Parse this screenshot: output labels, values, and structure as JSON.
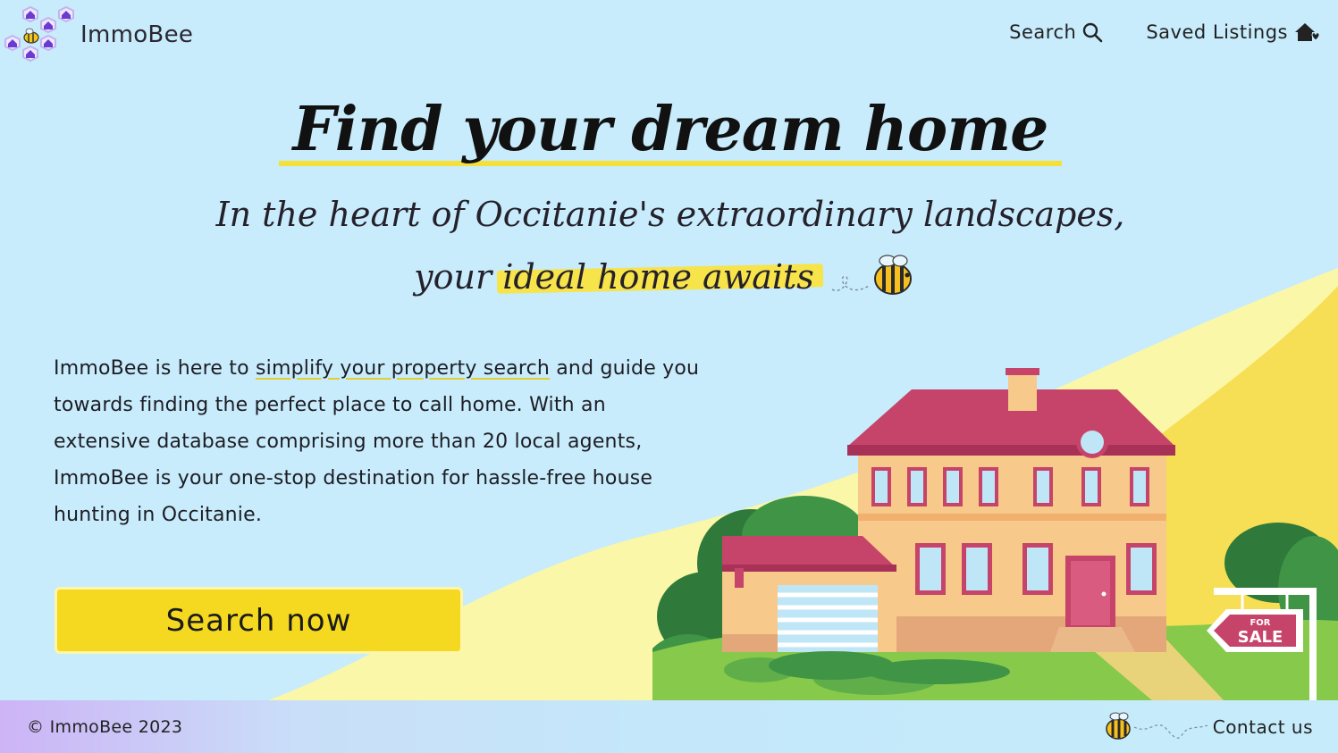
{
  "header": {
    "logo_text": "ImmoBee",
    "nav": {
      "search_label": "Search",
      "saved_label": "Saved Listings"
    }
  },
  "hero": {
    "title": "Find your dream home",
    "tagline_line1": "In the heart of Occitanie's extraordinary landscapes,",
    "tagline_line2_prefix": "your",
    "tagline_highlight": "ideal home awaits"
  },
  "intro": {
    "part1": "ImmoBee is here to ",
    "link_text": "simplify your property search",
    "part2": " and guide you towards finding the perfect place to call home. With an extensive database comprising more than 20 local agents, ImmoBee is your one-stop destination for hassle-free house hunting in Occitanie."
  },
  "cta": {
    "label": "Search now"
  },
  "illustration": {
    "sign_top": "FOR",
    "sign_bottom": "SALE"
  },
  "footer": {
    "copyright": "© ImmoBee 2023",
    "contact_label": "Contact us"
  },
  "colors": {
    "background": "#c8ecfc",
    "accent_yellow": "#f5d920",
    "highlight": "#f7e34a",
    "roof": "#c6446a",
    "house_wall": "#f7c98a",
    "footer_purple": "#cdb4f6"
  },
  "icons": [
    "search-icon",
    "house-heart-icon",
    "bee-icon",
    "honeycomb-logo-icon"
  ]
}
